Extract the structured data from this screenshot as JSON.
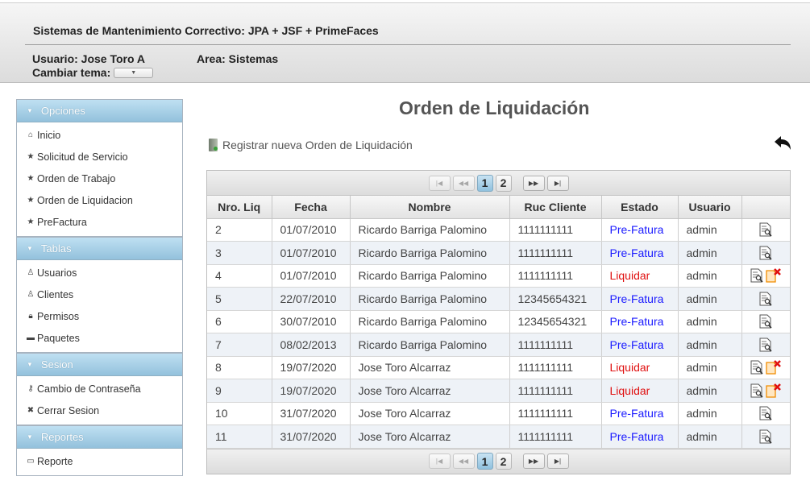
{
  "header": {
    "app_title": "Sistemas de Mantenimiento Correctivo: JPA + JSF + PrimeFaces",
    "user_label": "Usuario: Jose Toro A",
    "area_label": "Area: Sistemas",
    "theme_label": "Cambiar tema:"
  },
  "sidebar": {
    "panels": [
      {
        "title": "Opciones",
        "items": [
          {
            "label": "Inicio",
            "icon": "home-icon"
          },
          {
            "label": "Solicitud de Servicio",
            "icon": "star-icon"
          },
          {
            "label": "Orden de Trabajo",
            "icon": "star-icon"
          },
          {
            "label": "Orden de Liquidacion",
            "icon": "star-icon"
          },
          {
            "label": "PreFactura",
            "icon": "star-icon"
          }
        ]
      },
      {
        "title": "Tablas",
        "items": [
          {
            "label": "Usuarios",
            "icon": "user-icon"
          },
          {
            "label": "Clientes",
            "icon": "user-icon"
          },
          {
            "label": "Permisos",
            "icon": "lock-icon"
          },
          {
            "label": "Paquetes",
            "icon": "folder-icon"
          }
        ]
      },
      {
        "title": "Sesion",
        "items": [
          {
            "label": "Cambio de Contraseña",
            "icon": "key-icon"
          },
          {
            "label": "Cerrar Sesion",
            "icon": "close-icon"
          }
        ]
      },
      {
        "title": "Reportes",
        "items": [
          {
            "label": "Reporte",
            "icon": "document-icon"
          }
        ]
      }
    ]
  },
  "main": {
    "title": "Orden de Liquidación",
    "new_link": "Registrar nueva Orden de Liquidación"
  },
  "paginator": {
    "pages": [
      "1",
      "2"
    ],
    "current": "1"
  },
  "table": {
    "columns": [
      "Nro. Liq",
      "Fecha",
      "Nombre",
      "Ruc Cliente",
      "Estado",
      "Usuario",
      ""
    ],
    "rows": [
      {
        "nro": "2",
        "fecha": "01/07/2010",
        "nombre": "Ricardo Barriga Palomino",
        "ruc": "1111111111",
        "estado": "Pre-Fatura",
        "usuario": "admin",
        "can_cancel": false
      },
      {
        "nro": "3",
        "fecha": "01/07/2010",
        "nombre": "Ricardo Barriga Palomino",
        "ruc": "1111111111",
        "estado": "Pre-Fatura",
        "usuario": "admin",
        "can_cancel": false
      },
      {
        "nro": "4",
        "fecha": "01/07/2010",
        "nombre": "Ricardo Barriga Palomino",
        "ruc": "1111111111",
        "estado": "Liquidar",
        "usuario": "admin",
        "can_cancel": true
      },
      {
        "nro": "5",
        "fecha": "22/07/2010",
        "nombre": "Ricardo Barriga Palomino",
        "ruc": "12345654321",
        "estado": "Pre-Fatura",
        "usuario": "admin",
        "can_cancel": false
      },
      {
        "nro": "6",
        "fecha": "30/07/2010",
        "nombre": "Ricardo Barriga Palomino",
        "ruc": "12345654321",
        "estado": "Pre-Fatura",
        "usuario": "admin",
        "can_cancel": false
      },
      {
        "nro": "7",
        "fecha": "08/02/2013",
        "nombre": "Ricardo Barriga Palomino",
        "ruc": "1111111111",
        "estado": "Pre-Fatura",
        "usuario": "admin",
        "can_cancel": false
      },
      {
        "nro": "8",
        "fecha": "19/07/2020",
        "nombre": "Jose Toro Alcarraz",
        "ruc": "1111111111",
        "estado": "Liquidar",
        "usuario": "admin",
        "can_cancel": true
      },
      {
        "nro": "9",
        "fecha": "19/07/2020",
        "nombre": "Jose Toro Alcarraz",
        "ruc": "1111111111",
        "estado": "Liquidar",
        "usuario": "admin",
        "can_cancel": true
      },
      {
        "nro": "10",
        "fecha": "31/07/2020",
        "nombre": "Jose Toro Alcarraz",
        "ruc": "1111111111",
        "estado": "Pre-Fatura",
        "usuario": "admin",
        "can_cancel": false
      },
      {
        "nro": "11",
        "fecha": "31/07/2020",
        "nombre": "Jose Toro Alcarraz",
        "ruc": "1111111111",
        "estado": "Pre-Fatura",
        "usuario": "admin",
        "can_cancel": false
      }
    ]
  },
  "colors": {
    "status_pre": "#1a1aff",
    "status_liquidar": "#e01010",
    "panel_header": "#93c1dc",
    "current_page": "#90c1de"
  }
}
